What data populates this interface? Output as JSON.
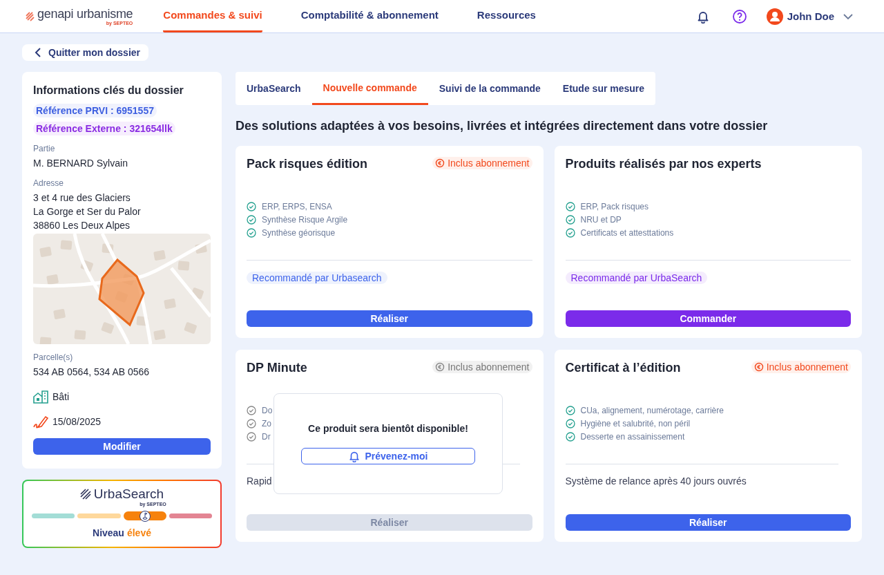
{
  "header": {
    "logo": {
      "name": "genapi urbanisme",
      "byline": "by SEPTEO"
    },
    "nav": [
      {
        "label": "Commandes & suivi",
        "selected": true
      },
      {
        "label": "Comptabilité & abonnement",
        "selected": false
      },
      {
        "label": "Ressources",
        "selected": false
      }
    ],
    "user": "John Doe"
  },
  "back_link": "Quitter mon dossier",
  "dossier": {
    "title": "Informations clés du dossier",
    "references": [
      {
        "text": "Référence PRVI : 6951557",
        "color": "#3d5fe0"
      },
      {
        "text": "Référence Externe : 321654llk",
        "color": "#8a2be2"
      }
    ],
    "party_label": "Partie",
    "party": "M. BERNARD Sylvain",
    "address_label": "Adresse",
    "address_lines": [
      "3 et 4 rue des Glaciers",
      "La Gorge et Ser du Palor",
      "38860 Les Deux Alpes"
    ],
    "map": {
      "kind": "picture"
    },
    "parcels_label": "Parcelle(s)",
    "parcels": "534 AB 0564, 534 AB 0566",
    "building": "Bâti",
    "date": "15/08/2025",
    "button": "Modifier"
  },
  "urbasearch": {
    "logo": "UrbaSearch",
    "byline": "by SEPTEO",
    "segments": [
      {
        "color": "#a3ddd6",
        "selected": false
      },
      {
        "color": "#fed89c",
        "selected": false
      },
      {
        "color": "#f6820d",
        "selected": true
      },
      {
        "color": "#e38593",
        "selected": false
      }
    ],
    "level_label": "Niveau",
    "level_value": "élevé"
  },
  "tabs": [
    {
      "label": "UrbaSearch",
      "selected": false
    },
    {
      "label": "Nouvelle commande",
      "selected": true
    },
    {
      "label": "Suivi de la commande",
      "selected": false
    },
    {
      "label": "Etude sur mesure",
      "selected": false
    }
  ],
  "heading": "Des solutions adaptées à vos besoins, livrées et intégrées directement dans votre dossier",
  "products": [
    {
      "title": "Pack risques édition",
      "badge": "Inclus abonnement",
      "disabled": false,
      "items": [
        "ERP, ERPS, ENSA",
        "Synthèse Risque Argile",
        "Synthèse géorisque"
      ],
      "recommendation": {
        "text": "Recommandé par Urbasearch",
        "kind": "blue"
      },
      "button": {
        "label": "Réaliser",
        "kind": "primary"
      }
    },
    {
      "title": "Produits réalisés par nos experts",
      "disabled": false,
      "items": [
        "ERP, Pack risques",
        "NRU et DP",
        "Certificats et attesttations"
      ],
      "recommendation": {
        "text": "Recommandé par UrbaSearch",
        "kind": "purple"
      },
      "button": {
        "label": "Commander",
        "kind": "purple"
      }
    },
    {
      "title": "DP Minute",
      "badge": "Inclus abonnement",
      "disabled": true,
      "items": [
        "Do",
        "Zo",
        "Dr"
      ],
      "note": "Rapid",
      "button": {
        "label": "Réaliser",
        "kind": "disabled"
      },
      "popup": {
        "message": "Ce produit sera bientôt disponible!",
        "button": "Prévenez-moi"
      }
    },
    {
      "title": "Certificat à l’édition",
      "badge": "Inclus abonnement",
      "disabled": false,
      "items": [
        "CUa, alignement, numérotage, carrière",
        "Hygiène et salubrité, non péril",
        "Desserte en assainissement"
      ],
      "note": "Système de relance après 40 jours ouvrés",
      "button": {
        "label": "Réaliser",
        "kind": "primary"
      }
    }
  ]
}
